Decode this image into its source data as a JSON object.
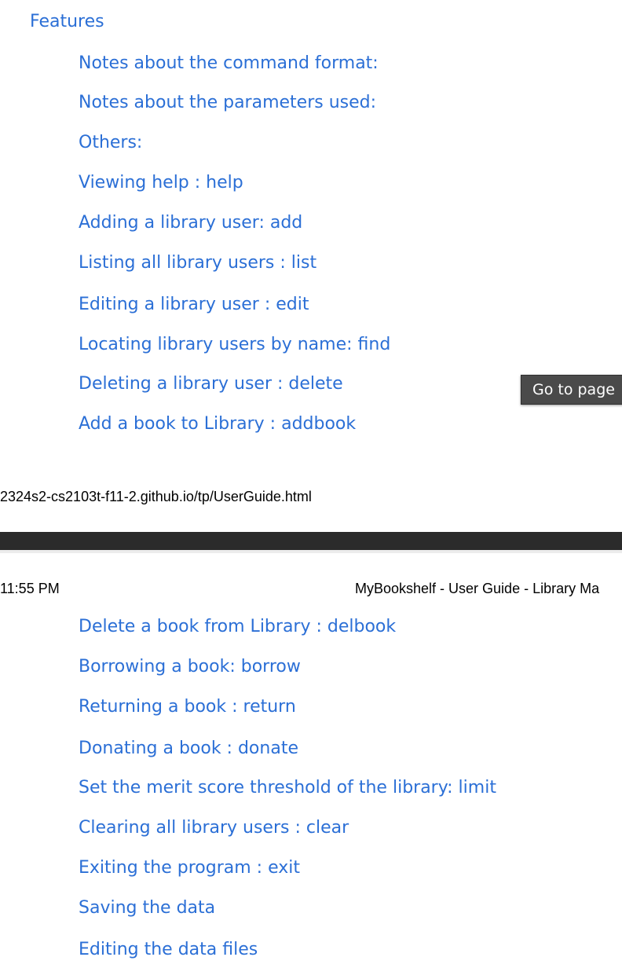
{
  "toc_top": {
    "features": "Features",
    "items": [
      "Notes about the command format:",
      "Notes about the parameters used:",
      "Others:",
      "Viewing help : help",
      "Adding a library user: add",
      "Listing all library users : list",
      "Editing a library user : edit",
      "Locating library users by name: find",
      "Deleting a library user : delete",
      "Add a book to Library : addbook"
    ]
  },
  "footer": {
    "url": "2324s2-cs2103t-f11-2.github.io/tp/UserGuide.html"
  },
  "header": {
    "time": "11:55 PM",
    "title": "MyBookshelf - User Guide - Library Ma"
  },
  "toc_bottom": {
    "items": [
      "Delete a book from Library : delbook",
      "Borrowing a book: borrow",
      "Returning a book : return",
      "Donating a book : donate",
      "Set the merit score threshold of the library: limit",
      "Clearing all library users : clear",
      "Exiting the program : exit",
      "Saving the data",
      "Editing the data files"
    ]
  },
  "tooltip": {
    "label": "Go to page"
  },
  "colors": {
    "link": "#2b6fd6",
    "divider": "#2b2b2b",
    "tooltip_bg": "#4a4a4a"
  }
}
